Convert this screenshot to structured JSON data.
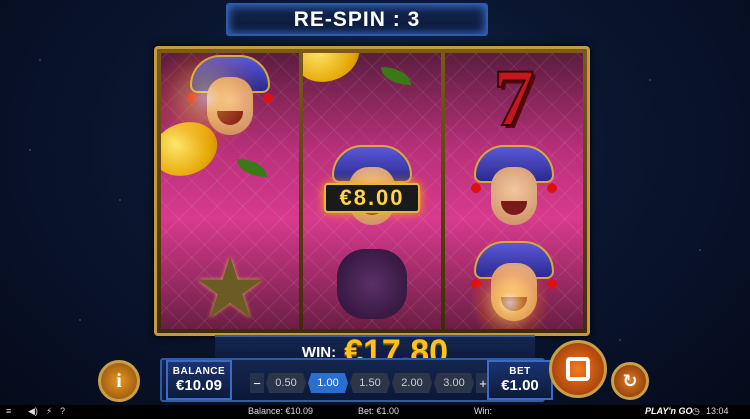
{
  "header": {
    "title": "RE-SPIN : 3"
  },
  "reels": {
    "reel1": [
      "jester",
      "lemon",
      "star"
    ],
    "reel2": [
      "lemon",
      "jester",
      "grapes"
    ],
    "reel3": [
      "seven",
      "jester",
      "jester"
    ]
  },
  "badge": {
    "value": "€8.00"
  },
  "win": {
    "label": "WIN:",
    "amount": "€17.80"
  },
  "balance": {
    "label": "BALANCE",
    "value": "€10.09"
  },
  "bet": {
    "label": "BET",
    "value": "€1.00"
  },
  "bet_options": {
    "minus": "−",
    "plus": "+",
    "values": [
      "0.50",
      "1.00",
      "1.50",
      "2.00",
      "3.00"
    ],
    "selected": "1.00"
  },
  "buttons": {
    "info": "i",
    "autoplay": "↻"
  },
  "status_bar": {
    "balance": "Balance: €10.09",
    "bet": "Bet: €1.00",
    "win": "Win:",
    "brand": "PLAY'n GO",
    "time": "13:04",
    "help": "?",
    "lightning": "⚡",
    "sound": "🔊",
    "menu": "≡",
    "volume_icon": "◀)",
    "clock_icon": "◷"
  },
  "colors": {
    "win_amount": "#ffc21a",
    "reel_bg": "#d83a8e",
    "accent_blue": "#2f5aa8"
  }
}
